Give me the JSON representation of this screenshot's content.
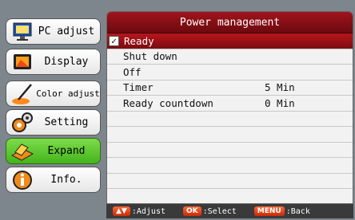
{
  "menu": {
    "items": [
      {
        "label": "PC adjust",
        "icon": "monitor-icon"
      },
      {
        "label": "Display",
        "icon": "picture-icon"
      },
      {
        "label": "Color adjust",
        "icon": "paint-brush-icon"
      },
      {
        "label": "Setting",
        "icon": "gears-icon"
      },
      {
        "label": "Expand",
        "icon": "projector-icon"
      },
      {
        "label": "Info.",
        "icon": "info-icon"
      }
    ],
    "active_index": 4
  },
  "panel": {
    "title": "Power management",
    "rows": [
      {
        "name": "Ready",
        "value": "",
        "selected": true,
        "checked": true
      },
      {
        "name": "Shut down",
        "value": ""
      },
      {
        "name": "Off",
        "value": ""
      },
      {
        "name": "Timer",
        "value": "5 Min"
      },
      {
        "name": "Ready countdown",
        "value": "0 Min"
      }
    ],
    "check_mark": "✓"
  },
  "bottom": {
    "adjust_key": "▲▼",
    "adjust_label": ":Adjust",
    "ok_key": "OK",
    "ok_label": ":Select",
    "menu_key": "MENU",
    "menu_label": ":Back"
  }
}
